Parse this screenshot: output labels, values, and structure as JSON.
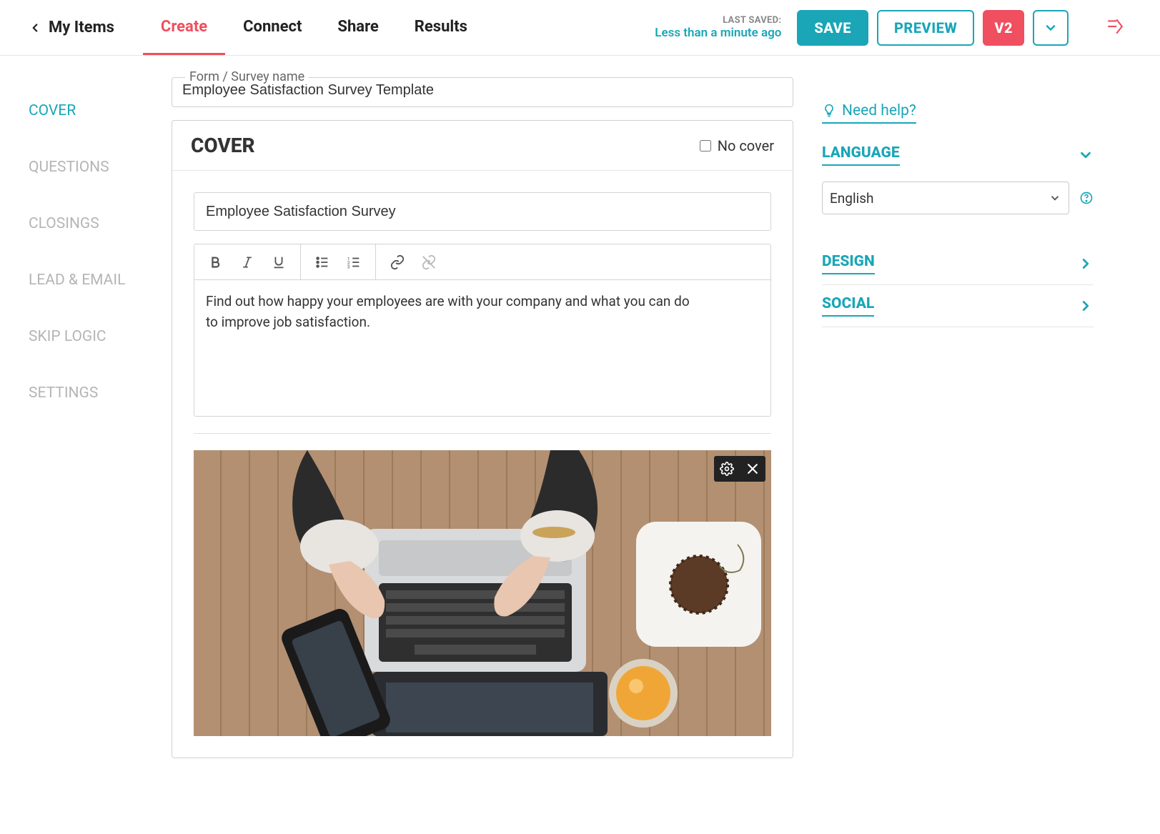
{
  "back_label": "My Items",
  "tabs": [
    "Create",
    "Connect",
    "Share",
    "Results"
  ],
  "active_tab_index": 0,
  "last_saved_label": "LAST SAVED:",
  "last_saved_time": "Less than a minute ago",
  "buttons": {
    "save": "SAVE",
    "preview": "PREVIEW",
    "version": "V2"
  },
  "leftnav": [
    "COVER",
    "QUESTIONS",
    "CLOSINGS",
    "LEAD & EMAIL",
    "SKIP LOGIC",
    "SETTINGS"
  ],
  "leftnav_active_index": 0,
  "form_name_label": "Form / Survey name",
  "form_name_value": "Employee Satisfaction Survey Template",
  "cover": {
    "panel_title": "COVER",
    "no_cover_label": "No cover",
    "no_cover_checked": false,
    "title_value": "Employee Satisfaction Survey",
    "description": "Find out how happy your employees are with your company and what you can do to improve job satisfaction."
  },
  "right": {
    "help_label": "Need help?",
    "sections": {
      "language": {
        "title": "LANGUAGE",
        "selected": "English",
        "open": true
      },
      "design": {
        "title": "DESIGN",
        "open": false
      },
      "social": {
        "title": "SOCIAL",
        "open": false
      }
    }
  }
}
